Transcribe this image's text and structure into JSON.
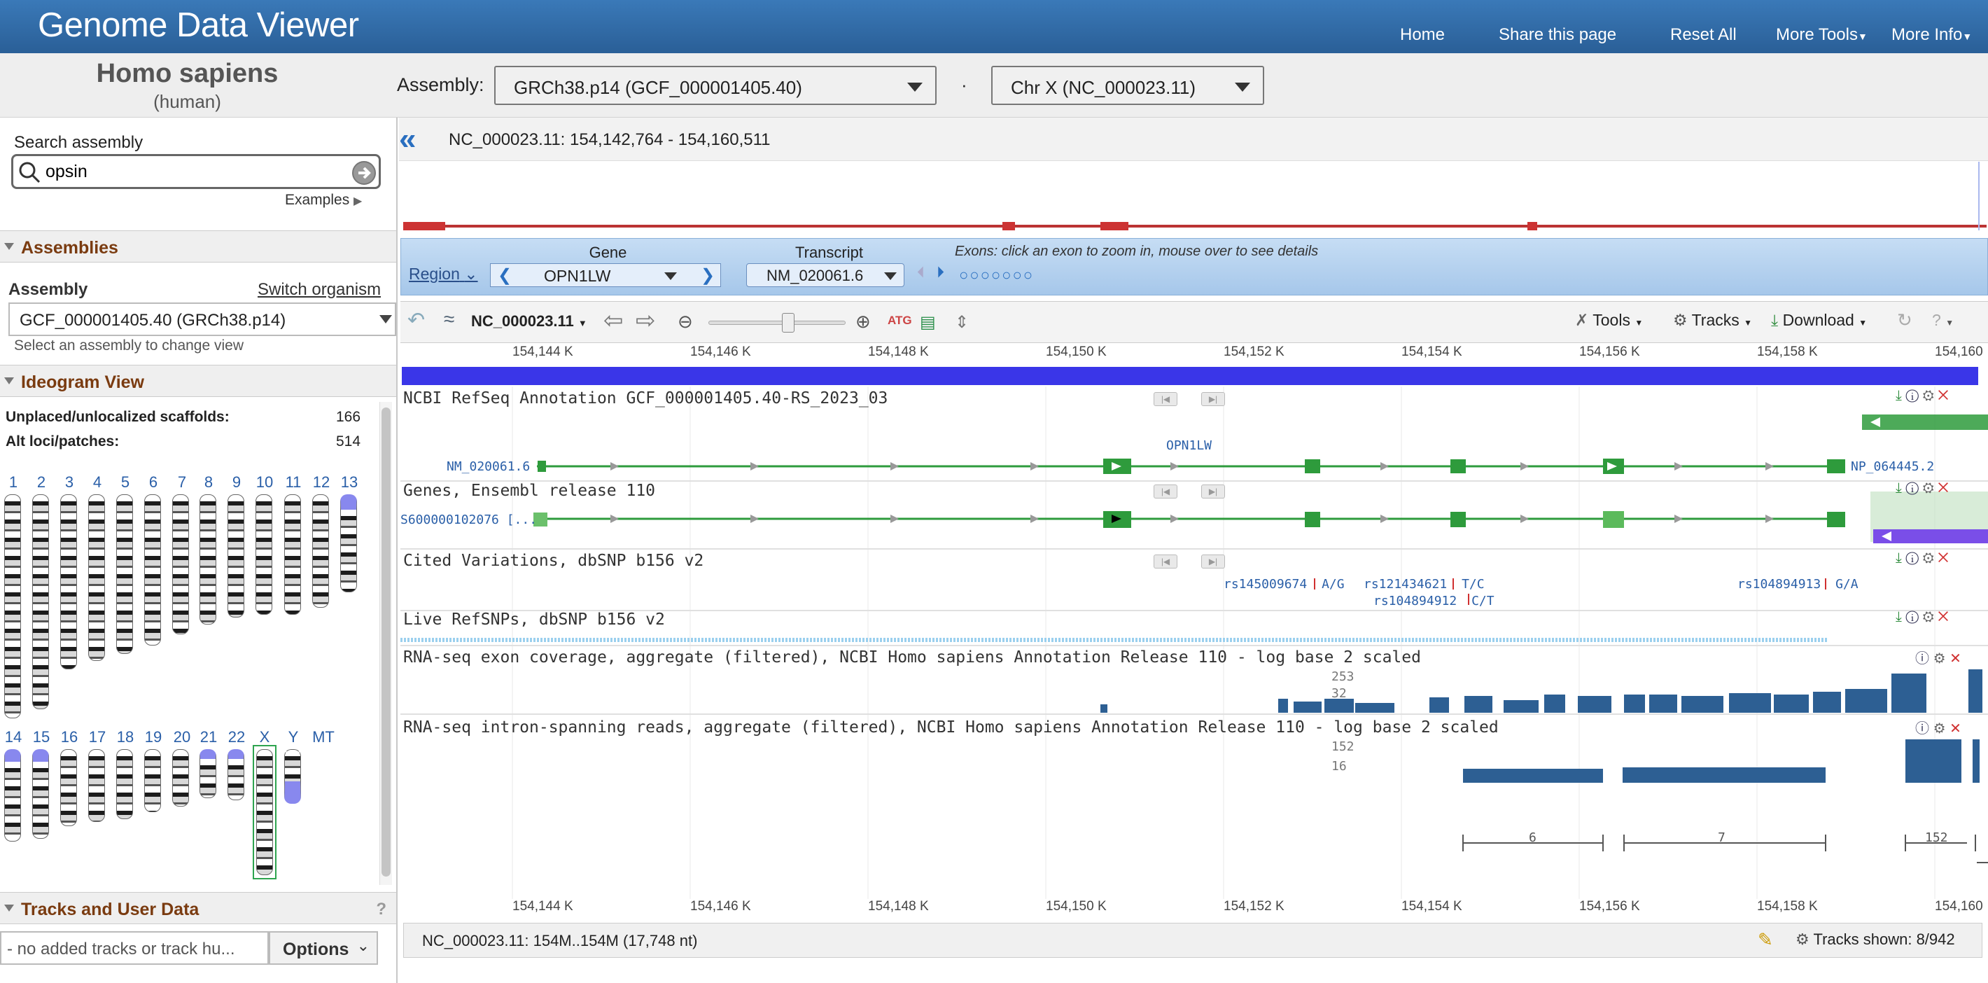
{
  "header": {
    "title": "Genome Data Viewer",
    "nav": [
      "Home",
      "Share this page",
      "Reset All",
      "More Tools",
      "More Info"
    ]
  },
  "organism": {
    "name": "Homo sapiens",
    "common": "(human)"
  },
  "assembly_bar": {
    "label": "Assembly:",
    "assembly_value": "GRCh38.p14 (GCF_000001405.40)",
    "separator": "·",
    "chromosome_value": "Chr X (NC_000023.11)"
  },
  "search": {
    "label": "Search assembly",
    "value": "opsin",
    "examples_label": "Examples"
  },
  "assemblies_section": {
    "title": "Assemblies",
    "assembly_label": "Assembly",
    "switch_label": "Switch organism",
    "select_value": "GCF_000001405.40 (GRCh38.p14)",
    "hint": "Select an assembly to change view"
  },
  "ideogram_section": {
    "title": "Ideogram View",
    "unplaced_label": "Unplaced/unlocalized scaffolds:",
    "unplaced_value": "166",
    "alt_label": "Alt loci/patches:",
    "alt_value": "514",
    "chromosomes": [
      "1",
      "2",
      "3",
      "4",
      "5",
      "6",
      "7",
      "8",
      "9",
      "10",
      "11",
      "12",
      "13",
      "14",
      "15",
      "16",
      "17",
      "18",
      "19",
      "20",
      "21",
      "22",
      "X",
      "Y",
      "MT"
    ],
    "selected": "X"
  },
  "tracks_section": {
    "title": "Tracks and User Data",
    "help": "?",
    "input_placeholder": "- no added tracks or track hu...",
    "options_label": "Options"
  },
  "viewer": {
    "location": "NC_000023.11:  154,142,764 - 154,160,511",
    "region_label": "Region",
    "gene_label": "Gene",
    "gene_value": "OPN1LW",
    "transcript_label": "Transcript",
    "transcript_value": "NM_020061.6",
    "exons_hint": "Exons: click an exon to zoom in, mouse over to see details",
    "seq_label": "NC_000023.11",
    "toolbar": {
      "tools": "Tools",
      "tracks": "Tracks",
      "download": "Download",
      "help": "?"
    },
    "ruler_ticks": [
      "154,144 K",
      "154,146 K",
      "154,148 K",
      "154,150 K",
      "154,152 K",
      "154,154 K",
      "154,156 K",
      "154,158 K",
      "154,160"
    ],
    "tracks": [
      {
        "title": "NCBI RefSeq Annotation GCF_000001405.40-RS_2023_03"
      },
      {
        "title": "Genes, Ensembl release 110"
      },
      {
        "title": "Cited Variations, dbSNP b156 v2"
      },
      {
        "title": "Live RefSNPs, dbSNP b156 v2"
      },
      {
        "title": "RNA-seq exon coverage, aggregate (filtered), NCBI Homo sapiens Annotation Release 110 - log base 2 scaled"
      },
      {
        "title": "RNA-seq intron-spanning reads, aggregate (filtered), NCBI Homo sapiens Annotation Release 110 - log base 2 scaled"
      }
    ],
    "feature_labels": {
      "gene_name": "OPN1LW",
      "refseq_left": "NM_020061.6",
      "refseq_right": "NP_064445.2",
      "ensembl_left": "S600000102076 [..."
    },
    "snps": [
      {
        "id": "rs145009674",
        "allele": "A/G"
      },
      {
        "id": "rs121434621",
        "allele": "T/C"
      },
      {
        "id": "rs104894912",
        "allele": "C/T"
      },
      {
        "id": "rs104894913",
        "allele": "G/A"
      }
    ],
    "coverage_scale": [
      "253",
      "32"
    ],
    "intron_scale": [
      "152",
      "16"
    ],
    "junction_counts": [
      "6",
      "7",
      "152"
    ],
    "status": "NC_000023.11: 154M..154M (17,748 nt)",
    "tracks_shown": "Tracks shown: 8/942"
  }
}
